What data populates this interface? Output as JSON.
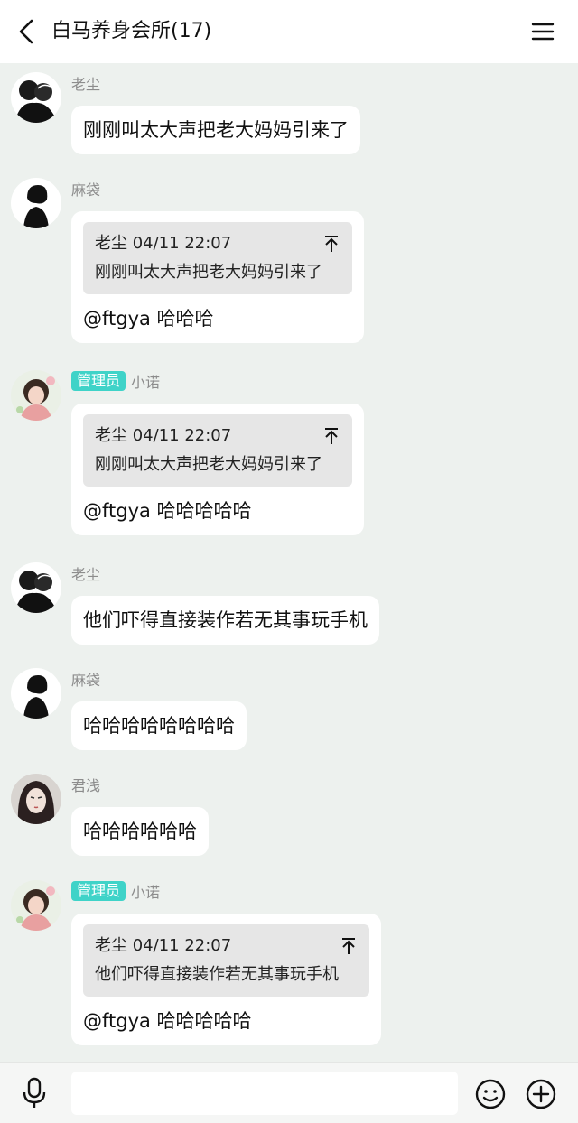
{
  "header": {
    "title": "白马养身会所(17)",
    "back_icon": "chevron-left-icon",
    "menu_icon": "hamburger-menu-icon"
  },
  "colors": {
    "chat_background": "#edf1ee",
    "bubble_background": "#ffffff",
    "quote_background": "#e6e6e6",
    "admin_badge": "#3fd3c8",
    "sender_name": "#8c8c8c"
  },
  "messages": [
    {
      "sender": "老尘",
      "text": "刚刚叫太大声把老大妈妈引来了"
    },
    {
      "sender": "麻袋",
      "quote": {
        "meta": "老尘 04/11 22:07",
        "text": "刚刚叫太大声把老大妈妈引来了"
      },
      "text": "@ftgya 哈哈哈"
    },
    {
      "badge": "管理员",
      "sender": "小诺",
      "quote": {
        "meta": "老尘 04/11 22:07",
        "text": "刚刚叫太大声把老大妈妈引来了"
      },
      "text": "@ftgya 哈哈哈哈哈"
    },
    {
      "sender": "老尘",
      "text": "他们吓得直接装作若无其事玩手机"
    },
    {
      "sender": "麻袋",
      "text": "哈哈哈哈哈哈哈哈"
    },
    {
      "sender": "君浅",
      "text": "哈哈哈哈哈哈"
    },
    {
      "badge": "管理员",
      "sender": "小诺",
      "quote": {
        "meta": "老尘 04/11 22:07",
        "text": "他们吓得直接装作若无其事玩手机"
      },
      "text": "@ftgya 哈哈哈哈哈"
    }
  ],
  "input_bar": {
    "placeholder": "",
    "mic_icon": "microphone-icon",
    "emoji_icon": "smiley-icon",
    "plus_icon": "plus-circle-icon"
  }
}
